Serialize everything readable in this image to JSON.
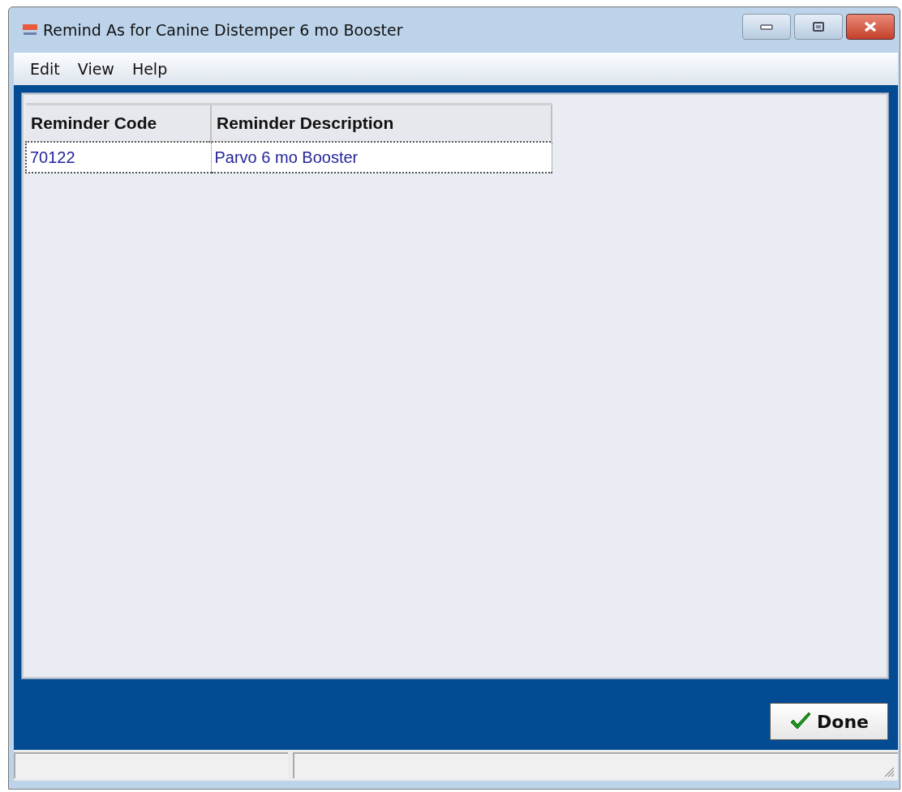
{
  "window": {
    "title": "Remind As for Canine Distemper 6 mo Booster"
  },
  "menu": [
    "Edit",
    "View",
    "Help"
  ],
  "table": {
    "columns": [
      "Reminder Code",
      "Reminder Description"
    ],
    "rows": [
      {
        "cells": [
          "70122",
          "Parvo 6 mo Booster"
        ],
        "selected": true
      }
    ]
  },
  "buttons": [
    {
      "label": "Done",
      "kind": "check"
    }
  ]
}
